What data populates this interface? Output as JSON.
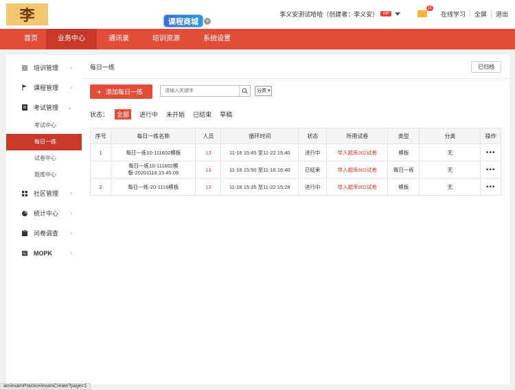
{
  "header": {
    "logo_text": "李",
    "promo_text": "课程商城",
    "close_glyph": "×",
    "user_text": "李义安测试哈哈（创建者：李义安）",
    "vip_badge": "VIP",
    "mail_badge": "11",
    "links": [
      "在线学习",
      "全屏",
      "退出"
    ]
  },
  "nav": {
    "items": [
      "首页",
      "业务中心",
      "通讯录",
      "培训资源",
      "系统设置"
    ],
    "active_index": 1
  },
  "sidebar": {
    "items": [
      {
        "label": "培训管理",
        "icon": "grid-icon",
        "chevron": "›"
      },
      {
        "label": "课程管理",
        "icon": "flag-icon",
        "chevron": "›"
      },
      {
        "label": "考试管理",
        "icon": "document-icon",
        "chevron": "⌄"
      },
      {
        "label": "社区管理",
        "icon": "apps-icon",
        "chevron": "›"
      },
      {
        "label": "统计中心",
        "icon": "pie-icon",
        "chevron": "›"
      },
      {
        "label": "问卷调查",
        "icon": "clipboard-icon",
        "chevron": "›"
      },
      {
        "label": "MOPK",
        "icon": "pk-icon",
        "chevron": "›"
      }
    ],
    "sub_items": [
      "考试中心",
      "每日一练",
      "试卷中心",
      "题库中心"
    ],
    "active_sub": 1
  },
  "main": {
    "title": "每日一练",
    "archived_button": "已归档",
    "add_button": "添加每日一练",
    "search_placeholder": "请输入关键字",
    "category_select": "分类",
    "status_label": "状态：",
    "status_filters": [
      "全部",
      "进行中",
      "未开始",
      "已结束",
      "草稿"
    ],
    "active_status": 0
  },
  "table": {
    "headers": [
      "序号",
      "每日一练名称",
      "人员",
      "循环时间",
      "状态",
      "所用试卷",
      "类型",
      "分类",
      "操作"
    ],
    "rows": [
      [
        "1",
        "每日一练10-111602模板",
        "13",
        "11-16 15:45 至11-22 15:40",
        "进行中",
        "导入题库002试卷",
        "模板",
        "无",
        "•••"
      ],
      [
        "",
        "每日一练10-111602模板-20201116.15.45.09",
        "13",
        "11-16 15:50 至11-16 16:40",
        "已结束",
        "导入题库002试卷",
        "每日一练",
        "无",
        "•••"
      ],
      [
        "2",
        "每日一练-20-1116模板",
        "13",
        "11-16 15:35 至11-22 15:29",
        "进行中",
        "导入题库002试卷",
        "模板",
        "无",
        "•••"
      ]
    ]
  },
  "status_bar": {
    "url": "am/examPractice/examCreate?page=1"
  },
  "colors": {
    "accent": "#e04e3a",
    "accent_dark": "#c8392a",
    "logo_bg": "#f1c870"
  }
}
